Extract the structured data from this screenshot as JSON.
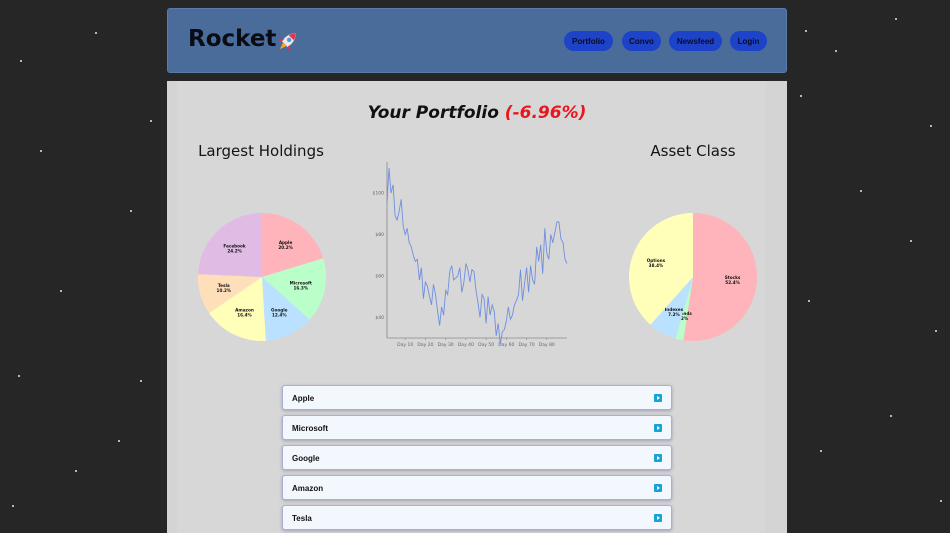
{
  "header": {
    "brand": "Rocket",
    "nav": [
      "Portfolio",
      "Convo",
      "Newsfeed",
      "Login"
    ]
  },
  "main": {
    "title": "Your Portfolio",
    "change": "(-6.96%)",
    "holdings_heading": "Largest Holdings",
    "asset_heading": "Asset Class"
  },
  "holdings_pie": {
    "slices": [
      {
        "name": "Apple",
        "pct": "20.2%",
        "value": 20.2,
        "color": "#ffb3ba"
      },
      {
        "name": "Microsoft",
        "pct": "16.3%",
        "value": 16.3,
        "color": "#baffc9"
      },
      {
        "name": "Google",
        "pct": "12.4%",
        "value": 12.4,
        "color": "#bae1ff"
      },
      {
        "name": "Amazon",
        "pct": "16.4%",
        "value": 16.4,
        "color": "#ffffba"
      },
      {
        "name": "Tesla",
        "pct": "10.2%",
        "value": 10.2,
        "color": "#ffdfba"
      },
      {
        "name": "Facebook",
        "pct": "24.2%",
        "value": 24.2,
        "color": "#e0bbe4"
      }
    ]
  },
  "asset_pie": {
    "slices": [
      {
        "name": "Stocks",
        "pct": "52.4%",
        "value": 52.4,
        "color": "#ffb3ba"
      },
      {
        "name": "Bonds",
        "pct": "2%",
        "value": 2.0,
        "color": "#baffc9"
      },
      {
        "name": "Indexes",
        "pct": "7.2%",
        "value": 7.2,
        "color": "#bae1ff"
      },
      {
        "name": "Options",
        "pct": "38.4%",
        "value": 38.4,
        "color": "#ffffba"
      }
    ]
  },
  "chart_data": {
    "type": "line",
    "title": "",
    "xlabel": "",
    "ylabel": "",
    "y_ticks": [
      "$40",
      "$60",
      "$80",
      "$100"
    ],
    "x_ticks": [
      "Day 10",
      "Day 20",
      "Day 30",
      "Day 40",
      "Day 50",
      "Day 60",
      "Day 70",
      "Day 80"
    ],
    "ylim": [
      30,
      115
    ],
    "xlim": [
      1,
      90
    ],
    "color": "#6f8fe0",
    "values": [
      95,
      112,
      100,
      104,
      89,
      87,
      91,
      97,
      84,
      80,
      83,
      76,
      74,
      70,
      67,
      68,
      58,
      64,
      49,
      57,
      55,
      50,
      46,
      56,
      51,
      43,
      36,
      45,
      41,
      53,
      51,
      62,
      65,
      58,
      59,
      60,
      64,
      52,
      57,
      66,
      63,
      57,
      63,
      62,
      53,
      47,
      40,
      51,
      49,
      37,
      50,
      41,
      46,
      43,
      31,
      37,
      27,
      33,
      34,
      38,
      45,
      39,
      41,
      46,
      48,
      51,
      63,
      48,
      56,
      64,
      52,
      65,
      58,
      56,
      74,
      67,
      75,
      61,
      83,
      71,
      68,
      80,
      76,
      81,
      86,
      86,
      78,
      76,
      68,
      66
    ],
    "grid": false
  },
  "stocks": [
    "Apple",
    "Microsoft",
    "Google",
    "Amazon",
    "Tesla"
  ]
}
